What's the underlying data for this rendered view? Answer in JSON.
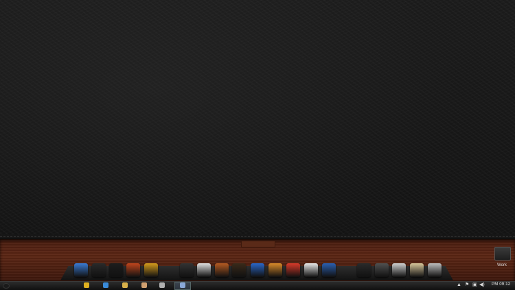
{
  "desktop": {
    "folders": [
      {
        "label": "Work"
      }
    ]
  },
  "dock": {
    "icons": [
      {
        "name": "display-icon",
        "color": "#3a7bd5"
      },
      {
        "name": "media-player-icon",
        "color": "#2a2a2a"
      },
      {
        "name": "camera-lens-icon",
        "color": "#1d1d1d"
      },
      {
        "name": "radio-icon",
        "color": "#c0451d"
      },
      {
        "name": "winamp-icon",
        "color": "#d49a1c"
      },
      {
        "name": "gimp-icon",
        "color": "#333333"
      },
      {
        "name": "chrome-icon",
        "color": "#e0e0e0"
      },
      {
        "name": "speaker-icon",
        "color": "#b55a22"
      },
      {
        "name": "cassette-icon",
        "color": "#3a2a1a"
      },
      {
        "name": "utorrent-icon",
        "color": "#2a66c8"
      },
      {
        "name": "box-app-icon",
        "color": "#d98a2a"
      },
      {
        "name": "coreldraw-icon",
        "color": "#d83a2a"
      },
      {
        "name": "photoshop-icon",
        "color": "#e8e8e8"
      },
      {
        "name": "word-icon",
        "color": "#2b5fb0"
      },
      {
        "name": "media-center-icon",
        "color": "#2a2a2a"
      },
      {
        "name": "terminal-icon",
        "color": "#505050"
      },
      {
        "name": "equalizer-icon",
        "color": "#cfcfcf"
      },
      {
        "name": "floppy-icon",
        "color": "#d8c79a"
      },
      {
        "name": "settings-icon",
        "color": "#bdbdbd"
      }
    ]
  },
  "taskbar": {
    "pinned": [
      {
        "name": "chrome-taskbar-icon",
        "color": "#e0b020"
      },
      {
        "name": "ie-taskbar-icon",
        "color": "#3a8ad8"
      },
      {
        "name": "explorer-taskbar-icon",
        "color": "#d8b04a"
      },
      {
        "name": "notepad-taskbar-icon",
        "color": "#d0a070"
      },
      {
        "name": "app-taskbar-icon",
        "color": "#b0b0b0"
      },
      {
        "name": "active-window-icon",
        "color": "#8aa8d8"
      }
    ],
    "tray": {
      "chevron": "▲",
      "flag": "⚑",
      "network": "▣",
      "volume": "◀)"
    },
    "clock": "PM 09:12"
  }
}
